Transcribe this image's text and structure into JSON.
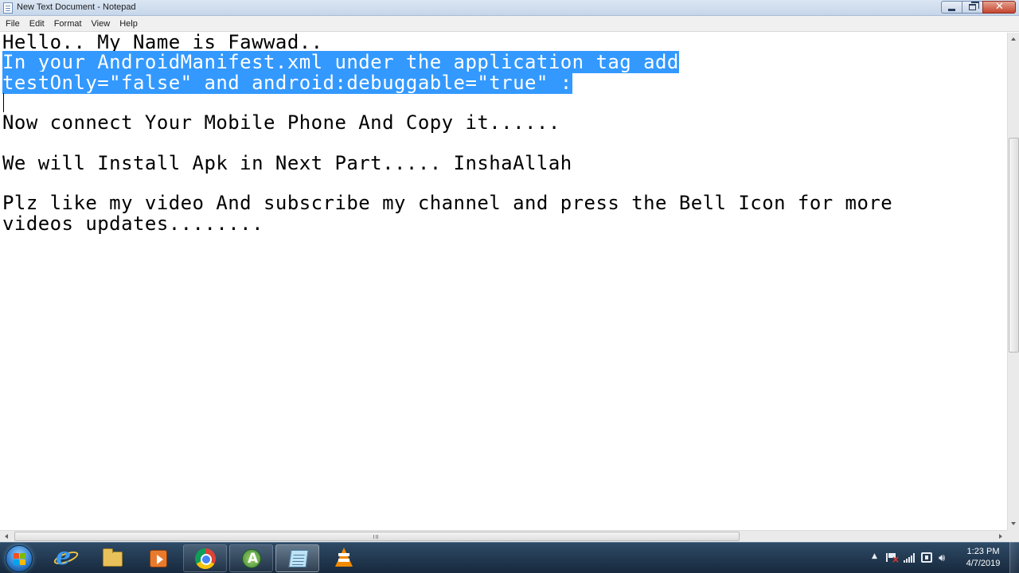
{
  "window": {
    "title": "New Text Document - Notepad",
    "icon": "notepad-icon"
  },
  "menu": [
    {
      "label": "File"
    },
    {
      "label": "Edit"
    },
    {
      "label": "Format"
    },
    {
      "label": "View"
    },
    {
      "label": "Help"
    }
  ],
  "editor": {
    "lines": [
      {
        "text": "Hello.. My Name is Fawwad..",
        "selected": false
      },
      {
        "text": "In your AndroidManifest.xml under the application tag add",
        "selected": true
      },
      {
        "text": "testOnly=\"false\" and android:debuggable=\"true\" :",
        "selected": true
      },
      {
        "text": "",
        "selected": false
      },
      {
        "text": "Now connect Your Mobile Phone And Copy it......",
        "selected": false
      },
      {
        "text": "",
        "selected": false
      },
      {
        "text": "We will Install Apk in Next Part..... InshaAllah",
        "selected": false
      },
      {
        "text": "",
        "selected": false
      },
      {
        "text": "Plz like my video And subscribe my channel and press the Bell Icon for more",
        "selected": false
      },
      {
        "text": "videos updates........",
        "selected": false
      }
    ],
    "selection_color": "#3399ff"
  },
  "taskbar": {
    "apps": [
      {
        "name": "internet-explorer-icon",
        "state": "pinned"
      },
      {
        "name": "file-explorer-icon",
        "state": "pinned"
      },
      {
        "name": "media-player-icon",
        "state": "pinned"
      },
      {
        "name": "chrome-icon",
        "state": "running"
      },
      {
        "name": "android-studio-icon",
        "state": "running"
      },
      {
        "name": "notepad-icon",
        "state": "active"
      },
      {
        "name": "vlc-icon",
        "state": "pinned"
      }
    ]
  },
  "clock": {
    "time": "1:23 PM",
    "date": "4/7/2019"
  }
}
